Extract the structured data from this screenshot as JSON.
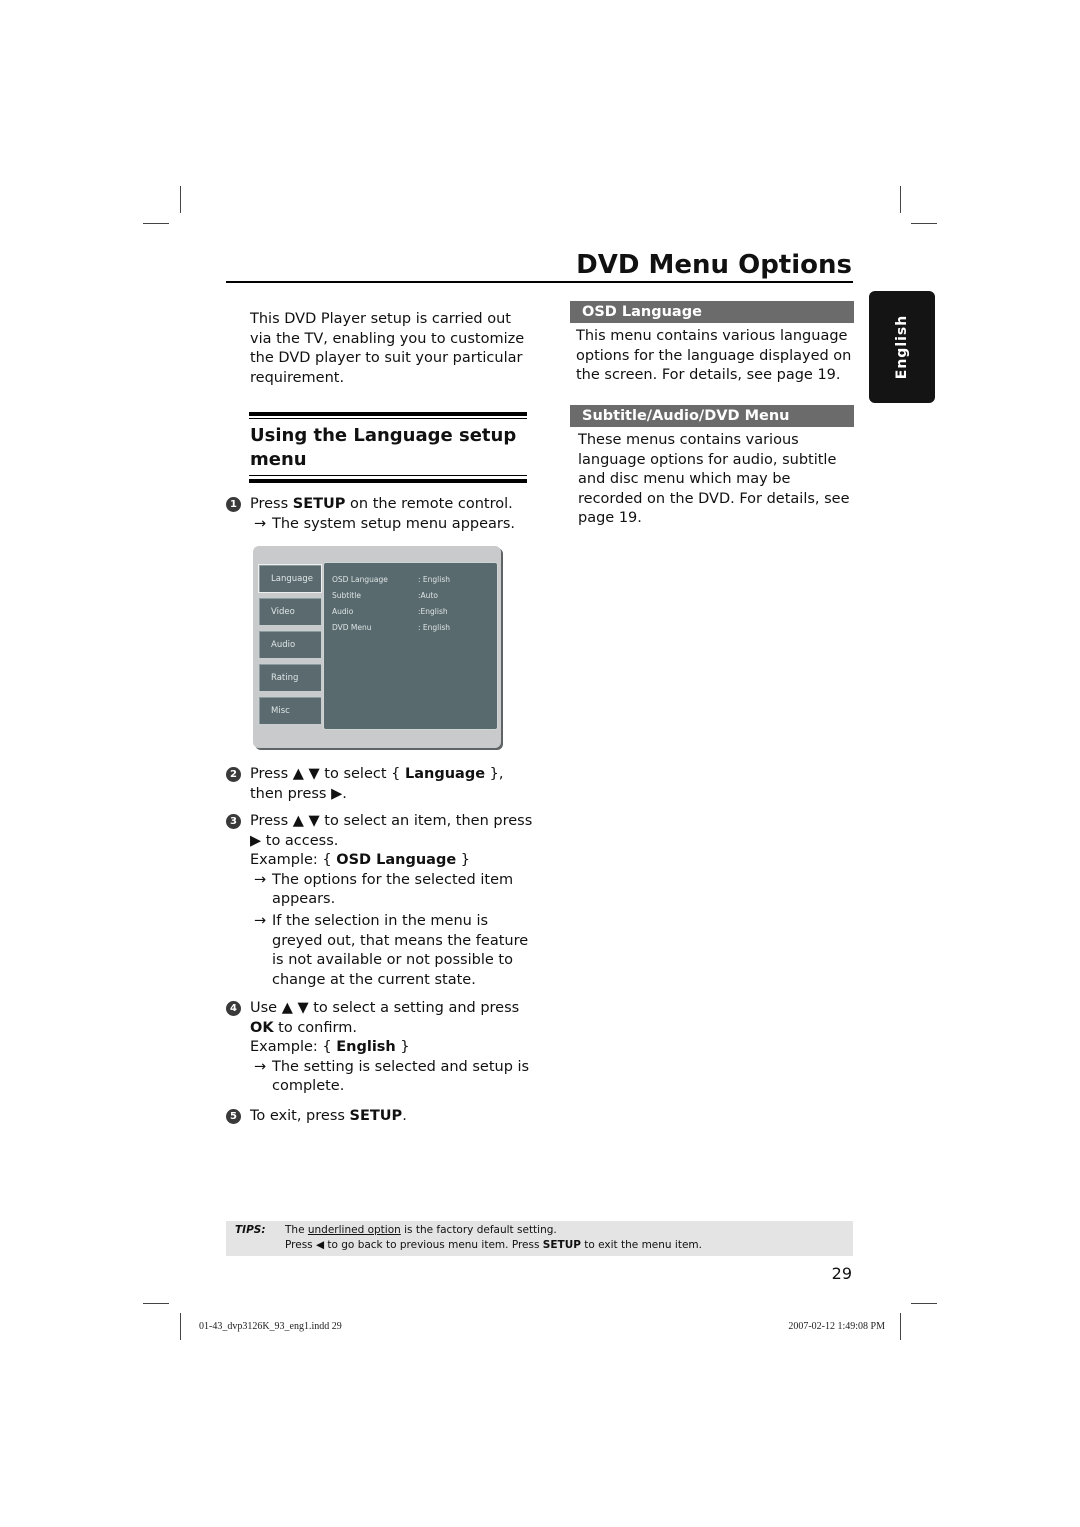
{
  "page": {
    "title": "DVD Menu Options",
    "page_number": "29",
    "side_tab": "English"
  },
  "intro": {
    "text": "This DVD Player setup is carried out via the TV, enabling you to customize the DVD player to suit your particular requirement."
  },
  "section": {
    "heading": "Using the Language setup menu"
  },
  "steps": [
    {
      "num": "1",
      "pre": "Press ",
      "bold": "SETUP",
      "post": " on the remote control.",
      "arrows": [
        "The system setup menu appears."
      ]
    },
    {
      "num": "2",
      "text_a": "Press ▲ ▼ to select { ",
      "bold": "Language",
      "text_b": " }, then press ▶."
    },
    {
      "num": "3",
      "text_a": "Press ▲ ▼ to select an item, then press ▶ to access.",
      "example_pre": "Example: { ",
      "example_bold": "OSD Language",
      "example_post": " }",
      "arrows": [
        "The options for the selected item appears.",
        "If the selection in the menu is greyed out, that means the feature is not available or not possible to change at the current state."
      ]
    },
    {
      "num": "4",
      "text_a": "Use ▲ ▼ to select a setting and press ",
      "bold": "OK",
      "text_b": " to confirm.",
      "example_pre": "Example: { ",
      "example_bold": "English",
      "example_post": " }",
      "arrows": [
        "The setting is selected and setup is complete."
      ]
    },
    {
      "num": "5",
      "pre": "To exit, press ",
      "bold": "SETUP",
      "post": "."
    }
  ],
  "osd_menu": {
    "tabs": [
      "Language",
      "Video",
      "Audio",
      "Rating",
      "Misc"
    ],
    "active_tab": "Language",
    "rows": [
      {
        "label": "OSD Language",
        "value": ": English"
      },
      {
        "label": "Subtitle",
        "value": ":Auto"
      },
      {
        "label": "Audio",
        "value": ":English"
      },
      {
        "label": "DVD Menu",
        "value": ": English"
      }
    ]
  },
  "right": {
    "osd_heading": "OSD Language",
    "osd_text": "This menu contains various language options for the language displayed on the screen. For details, see page 19.",
    "sub_heading": "Subtitle/Audio/DVD Menu",
    "sub_text": "These menus contains various language options for audio, subtitle and disc menu which may be recorded on the DVD. For details, see page 19."
  },
  "tips": {
    "label": "TIPS:",
    "line1_pre": "The ",
    "line1_underlined": "underlined option",
    "line1_post": " is the factory default setting.",
    "line2_pre": "Press ◀ to go back to previous menu item. Press ",
    "line2_bold": "SETUP",
    "line2_post": " to exit the menu item."
  },
  "footer": {
    "file": "01-43_dvp3126K_93_eng1.indd   29",
    "timestamp": "2007-02-12   1:49:08 PM"
  },
  "icons": {
    "arrow": "→"
  }
}
